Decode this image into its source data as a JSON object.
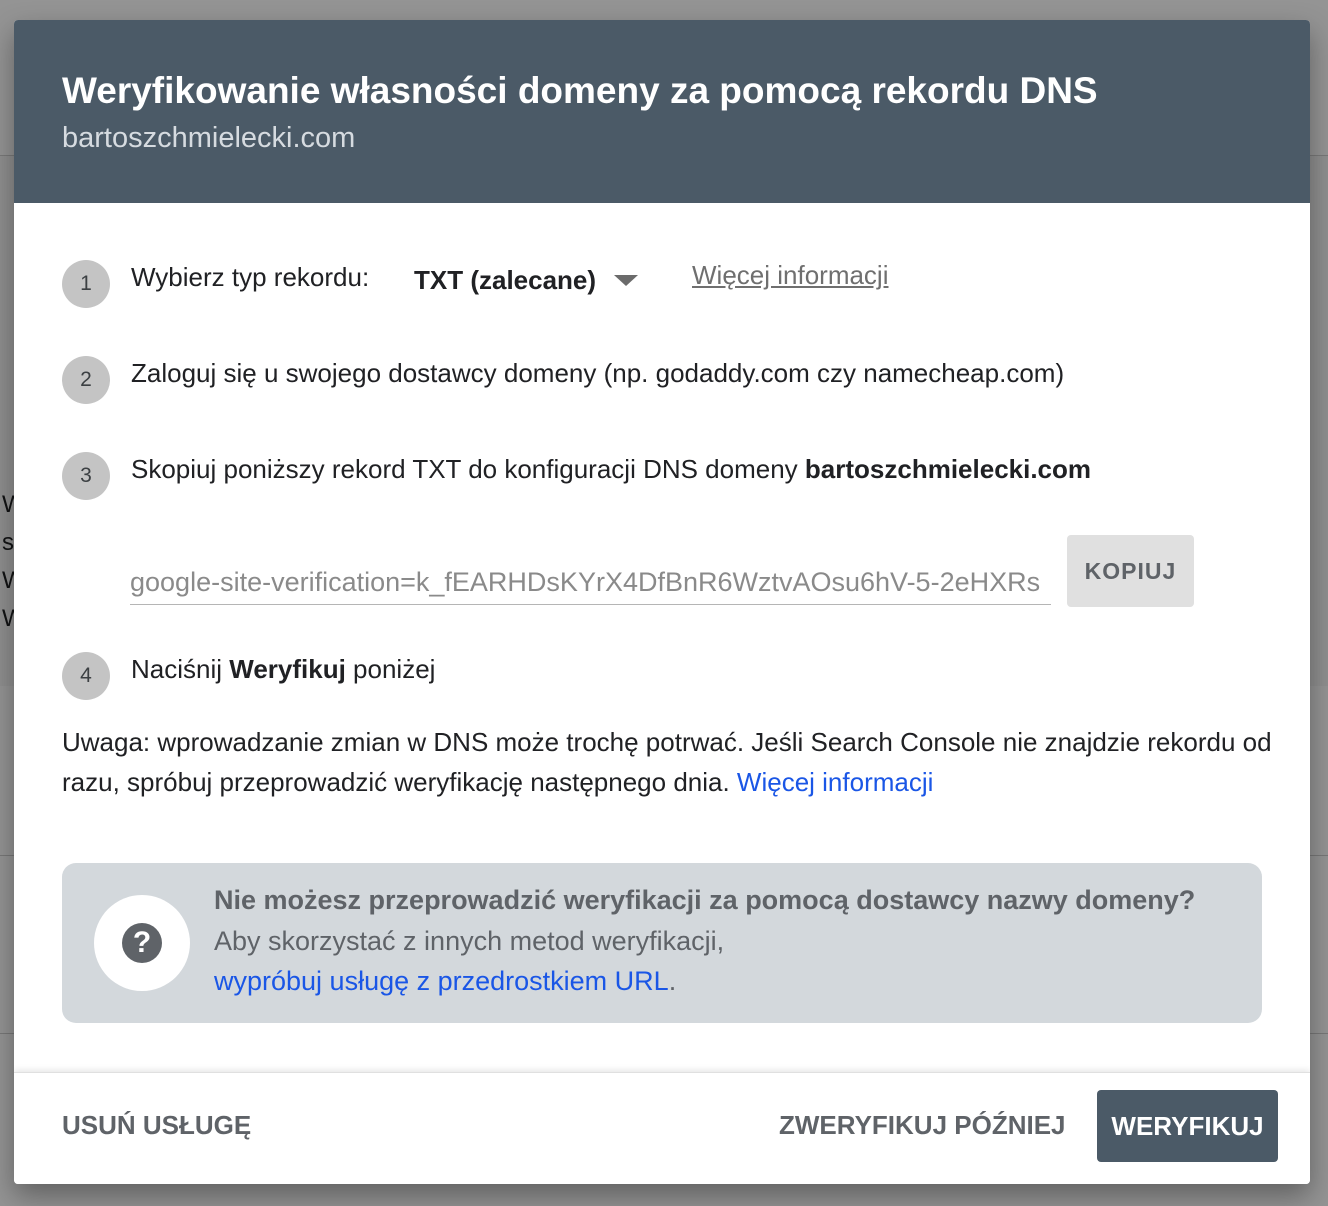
{
  "dialog": {
    "title": "Weryfikowanie własności domeny za pomocą rekordu DNS",
    "subtitle": "bartoszchmielecki.com"
  },
  "steps": [
    {
      "number": "1",
      "label": "Wybierz typ rekordu:",
      "record_type_selected": "TXT (zalecane)",
      "more_info_link": "Więcej informacji"
    },
    {
      "number": "2",
      "text": "Zaloguj się u swojego dostawcy domeny (np. godaddy.com czy namecheap.com)"
    },
    {
      "number": "3",
      "text_prefix": "Skopiuj poniższy rekord TXT do konfiguracji DNS domeny ",
      "domain_bold": "bartoszchmielecki.com",
      "txt_record_value": "google-site-verification=k_fEARHDsKYrX4DfBnR6WztvAOsu6hV-5-2eHXRs",
      "copy_button_label": "KOPIUJ"
    },
    {
      "number": "4",
      "text_before": "Naciśnij ",
      "text_bold": "Weryfikuj",
      "text_after": " poniżej"
    }
  ],
  "note": {
    "text": "Uwaga: wprowadzanie zmian w DNS może trochę potrwać. Jeśli Search Console nie znajdzie rekordu od razu, spróbuj przeprowadzić weryfikację następnego dnia. ",
    "link": "Więcej informacji"
  },
  "info_box": {
    "icon": "help-icon",
    "title": "Nie możesz przeprowadzić weryfikacji za pomocą dostawcy nazwy domeny?",
    "line1": "Aby skorzystać z innych metod weryfikacji,",
    "link": "wypróbuj usługę z przedrostkiem URL",
    "link_suffix": "."
  },
  "footer": {
    "remove_label": "USUŃ USŁUGĘ",
    "later_label": "ZWERYFIKUJ PÓŹNIEJ",
    "verify_label": "WERYFIKUJ"
  },
  "background": {
    "side_letters": [
      "W",
      "s",
      "W",
      "W"
    ]
  },
  "colors": {
    "header_bg": "#4b5a67",
    "link_blue": "#1a56e6",
    "info_box_bg": "#d3d8dc",
    "primary_button_bg": "#4b5a67"
  }
}
